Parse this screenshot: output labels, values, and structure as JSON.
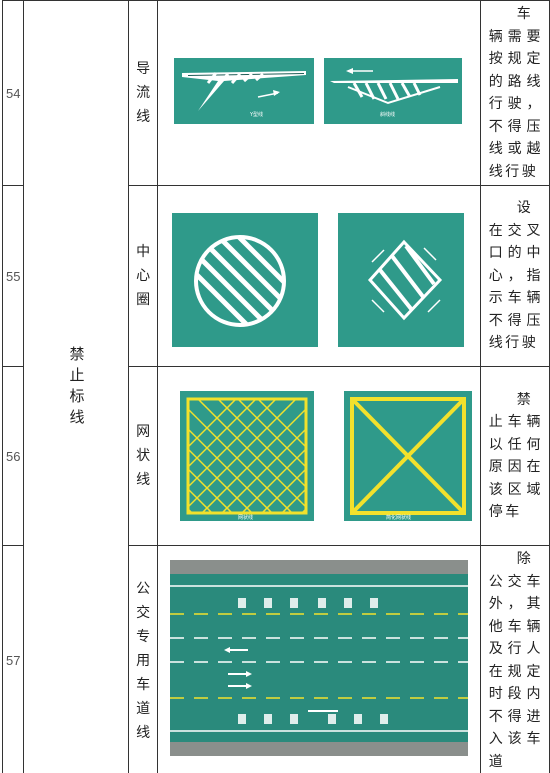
{
  "category": "禁止标线",
  "rows": [
    {
      "number": "54",
      "name": "导流线",
      "description": "车辆需要按规定的路线行驶，不得压线或越线行驶",
      "panels": [
        {
          "caption": "Y型线"
        },
        {
          "caption": "斜线线"
        }
      ]
    },
    {
      "number": "55",
      "name": "中心圈",
      "description": "设在交叉口的中心，指示车辆不得压线行驶",
      "panels": [
        {
          "caption": ""
        },
        {
          "caption": ""
        }
      ]
    },
    {
      "number": "56",
      "name": "网状线",
      "description": "禁止车辆以任何原因在该区域停车",
      "panels": [
        {
          "caption": "网状线"
        },
        {
          "caption": "简化网状线"
        }
      ]
    },
    {
      "number": "57",
      "name": "公交专用车道线",
      "description": "除公交车外，其他车辆及行人在规定时段内不得进入该车道",
      "panels": [
        {
          "caption": ""
        }
      ]
    }
  ],
  "colors": {
    "road": "#2f9a8a",
    "road_dark": "#1f5e57",
    "marking_white": "#ffffff",
    "marking_yellow": "#f2e12c"
  }
}
